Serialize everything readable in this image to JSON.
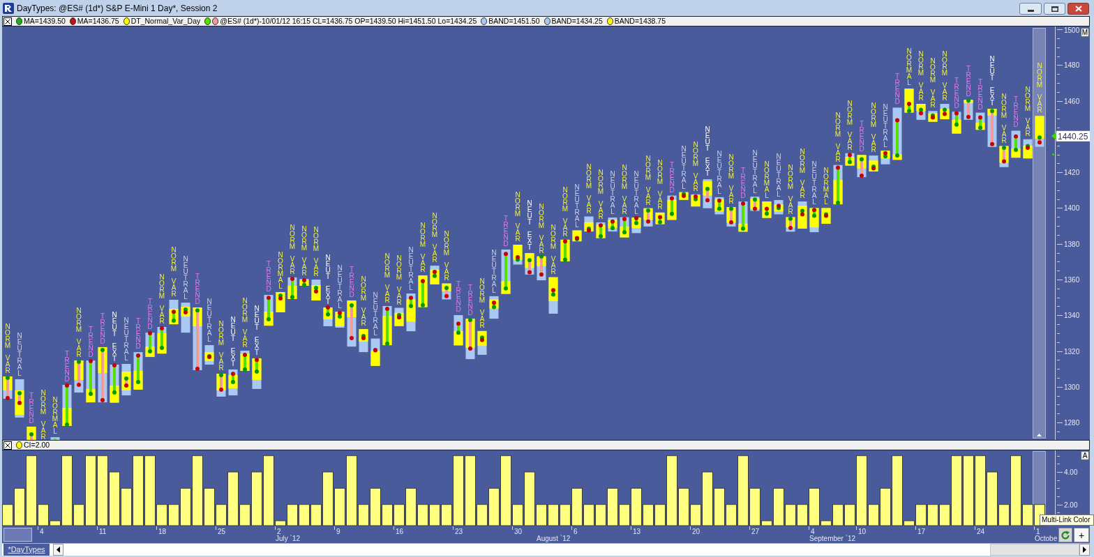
{
  "window": {
    "title": "DayTypes: @ES# (1d*) S&P E-Mini 1 Day*, Session 2"
  },
  "legend": {
    "items": [
      {
        "text": "MA=1439.50",
        "markers": [
          {
            "color": "#22aa22"
          }
        ]
      },
      {
        "text": "MA=1436.75",
        "markers": [
          {
            "color": "#c01010"
          }
        ]
      },
      {
        "text": "DT_Normal_Var_Day",
        "markers": [
          {
            "color": "#ffff00"
          }
        ]
      },
      {
        "text": "@ES# (1d*)-10/01/12 16:15 CL=1436.75 OP=1439.50 Hi=1451.50 Lo=1434.25",
        "markers": [
          {
            "color": "#55e000"
          },
          {
            "color": "#f59a9a"
          }
        ]
      },
      {
        "text": "BAND=1451.50",
        "markers": [
          {
            "color": "#a9c8f2"
          }
        ]
      },
      {
        "text": "BAND=1434.25",
        "markers": [
          {
            "color": "#a9c8f2"
          }
        ]
      },
      {
        "text": "BAND=1438.75",
        "markers": [
          {
            "color": "#ffff00"
          }
        ]
      }
    ]
  },
  "price_chart": {
    "axis_button": "M",
    "day_type_labels": [
      {
        "text": "NORM VAR",
        "color": "#f0f040"
      },
      {
        "text": "NEUTRAL",
        "color": "#ccd0ea"
      },
      {
        "text": "TREND",
        "color": "#e878f0"
      },
      {
        "text": "NORM VAR",
        "color": "#f0f040"
      },
      {
        "text": "NORMAL",
        "color": "#f0f040"
      },
      {
        "text": "TREND",
        "color": "#e878f0"
      },
      {
        "text": "NORM VAR",
        "color": "#f0f040"
      },
      {
        "text": "TREND",
        "color": "#e878f0"
      },
      {
        "text": "TREND",
        "color": "#e878f0"
      },
      {
        "text": "NEUT EXT",
        "color": "#ffffff"
      },
      {
        "text": "NEUTRAL",
        "color": "#ccd0ea"
      },
      {
        "text": "TREND",
        "color": "#e878f0"
      },
      {
        "text": "TREND",
        "color": "#e878f0"
      },
      {
        "text": "NORM VAR",
        "color": "#f0f040"
      },
      {
        "text": "NORM VAR",
        "color": "#f0f040"
      },
      {
        "text": "NEUTRAL",
        "color": "#ccd0ea"
      },
      {
        "text": "TREND",
        "color": "#e878f0"
      },
      {
        "text": "NEUTRAL",
        "color": "#ccd0ea"
      },
      {
        "text": "NORM VAR",
        "color": "#f0f040"
      },
      {
        "text": "NEUT EXT",
        "color": "#ffffff"
      },
      {
        "text": "NORM VAR",
        "color": "#f0f040"
      },
      {
        "text": "NEUT EXT",
        "color": "#ffffff"
      },
      {
        "text": "TREND",
        "color": "#e878f0"
      },
      {
        "text": "NORMAL",
        "color": "#f0f040"
      },
      {
        "text": "NORM VAR",
        "color": "#f0f040"
      },
      {
        "text": "NORM VAR",
        "color": "#f0f040"
      },
      {
        "text": "NORM VAR",
        "color": "#f0f040"
      },
      {
        "text": "NEUT EXT",
        "color": "#ffffff"
      },
      {
        "text": "NEUTRAL",
        "color": "#ccd0ea"
      },
      {
        "text": "TREND",
        "color": "#e878f0"
      },
      {
        "text": "NORM VAR",
        "color": "#f0f040"
      },
      {
        "text": "NEUTRAL",
        "color": "#ccd0ea"
      },
      {
        "text": "NORM VAR",
        "color": "#f0f040"
      },
      {
        "text": "NORM VAR",
        "color": "#f0f040"
      },
      {
        "text": "NEUTRAL",
        "color": "#ccd0ea"
      },
      {
        "text": "NORM VAR",
        "color": "#f0f040"
      },
      {
        "text": "NORM VAR",
        "color": "#f0f040"
      },
      {
        "text": "NORM VAR",
        "color": "#f0f040"
      },
      {
        "text": "TREND",
        "color": "#e878f0"
      },
      {
        "text": "TREND",
        "color": "#e878f0"
      },
      {
        "text": "NORM VAR",
        "color": "#f0f040"
      },
      {
        "text": "NEUTRAL",
        "color": "#ccd0ea"
      },
      {
        "text": "TREND",
        "color": "#e878f0"
      },
      {
        "text": "NORM VAR",
        "color": "#f0f040"
      },
      {
        "text": "NEUT EXT",
        "color": "#ffffff"
      },
      {
        "text": "NORM VAR",
        "color": "#f0f040"
      },
      {
        "text": "NORM VAR",
        "color": "#f0f040"
      },
      {
        "text": "NORM VAR",
        "color": "#f0f040"
      },
      {
        "text": "NEUTRAL",
        "color": "#ccd0ea"
      },
      {
        "text": "NORM VAR",
        "color": "#f0f040"
      },
      {
        "text": "NORM VAR",
        "color": "#f0f040"
      },
      {
        "text": "NEUTRAL",
        "color": "#ccd0ea"
      },
      {
        "text": "NORM VAR",
        "color": "#f0f040"
      },
      {
        "text": "NEUTRAL",
        "color": "#ccd0ea"
      },
      {
        "text": "NORM VAR",
        "color": "#f0f040"
      },
      {
        "text": "NORM VAR",
        "color": "#f0f040"
      },
      {
        "text": "TREND",
        "color": "#e878f0"
      },
      {
        "text": "NEUTRAL",
        "color": "#ccd0ea"
      },
      {
        "text": "NORM VAR",
        "color": "#f0f040"
      },
      {
        "text": "NEUT EXT",
        "color": "#ffffff"
      },
      {
        "text": "NEUTRAL",
        "color": "#ccd0ea"
      },
      {
        "text": "NORM VAR",
        "color": "#f0f040"
      },
      {
        "text": "TREND",
        "color": "#e878f0"
      },
      {
        "text": "NEUTRAL",
        "color": "#ccd0ea"
      },
      {
        "text": "NORMAL",
        "color": "#f0f040"
      },
      {
        "text": "NEUTRAL",
        "color": "#ccd0ea"
      },
      {
        "text": "NORM VAR",
        "color": "#f0f040"
      },
      {
        "text": "NORM VAR",
        "color": "#f0f040"
      },
      {
        "text": "NEUTRAL",
        "color": "#ccd0ea"
      },
      {
        "text": "NORMAL",
        "color": "#f0f040"
      },
      {
        "text": "NORM VAR",
        "color": "#f0f040"
      },
      {
        "text": "NORM VAR",
        "color": "#f0f040"
      },
      {
        "text": "TREND",
        "color": "#e878f0"
      },
      {
        "text": "NORM VAR",
        "color": "#f0f040"
      },
      {
        "text": "NEUTRAL",
        "color": "#ccd0ea"
      },
      {
        "text": "TREND",
        "color": "#e878f0"
      },
      {
        "text": "NORMAL",
        "color": "#f0f040"
      },
      {
        "text": "NORM VAR",
        "color": "#f0f040"
      },
      {
        "text": "NORM VAR",
        "color": "#f0f040"
      },
      {
        "text": "NORM VAR",
        "color": "#f0f040"
      },
      {
        "text": "TREND",
        "color": "#e878f0"
      },
      {
        "text": "TREND",
        "color": "#e878f0"
      },
      {
        "text": "TREND",
        "color": "#e878f0"
      },
      {
        "text": "NEUT EXT",
        "color": "#ffffff"
      },
      {
        "text": "NORM VAR",
        "color": "#f0f040"
      },
      {
        "text": "TREND",
        "color": "#e878f0"
      },
      {
        "text": "NORM VAR",
        "color": "#f0f040"
      },
      {
        "text": "NORM VAR",
        "color": "#f0f040"
      }
    ],
    "axis_labels": [
      "1500",
      "1480",
      "1460",
      "1420",
      "1400",
      "1380",
      "1360",
      "1340",
      "1320",
      "1300",
      "1280"
    ],
    "last_price": "1440.25"
  },
  "ci_legend": {
    "items": [
      {
        "text": "CI=2.00",
        "markers": [
          {
            "color": "#ffff00"
          }
        ]
      }
    ]
  },
  "ci_chart": {
    "axis_button": "A",
    "chart_data": {
      "type": "bar",
      "ylim": [
        0.7,
        5.33
      ],
      "yticks": [
        {
          "value": 2,
          "label": "2.00"
        },
        {
          "value": 4,
          "label": "4.00"
        }
      ],
      "categories": [
        null,
        null,
        null,
        "4",
        null,
        null,
        null,
        null,
        "11",
        null,
        null,
        null,
        null,
        "18",
        null,
        null,
        null,
        null,
        "25",
        null,
        null,
        null,
        null,
        "2",
        null,
        null,
        null,
        null,
        "9",
        null,
        null,
        null,
        null,
        "16",
        null,
        null,
        null,
        null,
        "23",
        null,
        null,
        null,
        null,
        "30",
        null,
        null,
        null,
        null,
        "6",
        null,
        null,
        null,
        null,
        "13",
        null,
        null,
        null,
        null,
        "20",
        null,
        null,
        null,
        null,
        "27",
        null,
        null,
        null,
        null,
        "4",
        null,
        null,
        null,
        "10",
        null,
        null,
        null,
        null,
        "17",
        null,
        null,
        null,
        null,
        "24",
        null,
        null,
        null,
        null,
        "1"
      ],
      "series": [
        {
          "values": [
            2,
            3,
            5,
            2,
            1,
            5,
            2,
            5,
            5,
            4,
            3,
            5,
            5,
            2,
            2,
            3,
            5,
            3,
            2,
            4,
            2,
            4,
            5,
            1,
            2,
            2,
            2,
            4,
            3,
            5,
            2,
            3,
            2,
            2,
            3,
            2,
            2,
            2,
            5,
            5,
            2,
            3,
            5,
            2,
            4,
            2,
            2,
            2,
            3,
            2,
            2,
            3,
            2,
            3,
            2,
            2,
            5,
            3,
            2,
            4,
            3,
            2,
            5,
            3,
            1,
            3,
            2,
            2,
            3,
            1,
            2,
            2,
            5,
            2,
            3,
            5,
            1,
            2,
            2,
            2,
            5,
            5,
            5,
            4,
            2,
            5,
            2,
            2
          ]
        }
      ],
      "annotations": [
        "July `12",
        "August `12",
        "September `12",
        "Octobe"
      ]
    }
  },
  "tooltip": "Multi-Link Color",
  "controls": {
    "add_button": "+"
  },
  "tabs": [
    {
      "label": "*DayTypes",
      "selected": true
    }
  ]
}
